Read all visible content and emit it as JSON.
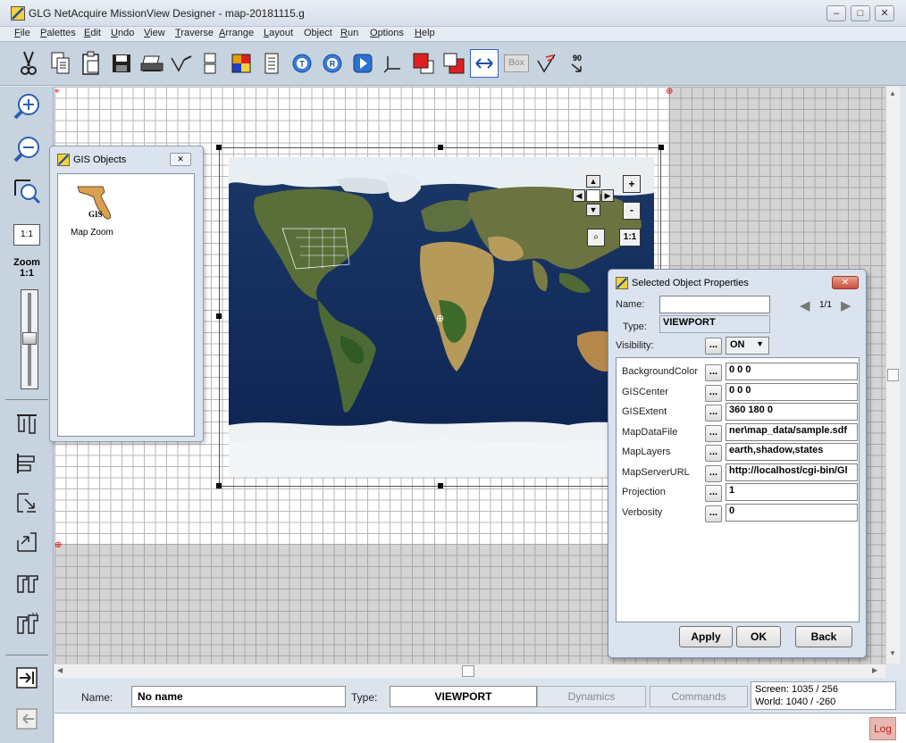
{
  "window": {
    "title": "GLG NetAcquire MissionView Designer - map-20181115.g",
    "controls": {
      "minimize": "–",
      "maximize": "□",
      "close": "✕"
    }
  },
  "menu": [
    {
      "label": "File",
      "ul": "F",
      "rest": "ile"
    },
    {
      "label": "Palettes",
      "ul": "P",
      "rest": "alettes"
    },
    {
      "label": "Edit",
      "ul": "E",
      "rest": "dit"
    },
    {
      "label": "Undo",
      "ul": "U",
      "rest": "ndo"
    },
    {
      "label": "View",
      "ul": "V",
      "rest": "iew"
    },
    {
      "label": "Traverse",
      "ul": "T",
      "rest": "raverse"
    },
    {
      "label": "Arrange",
      "ul": "A",
      "rest": "rrange"
    },
    {
      "label": "Layout",
      "ul": "L",
      "rest": "ayout"
    },
    {
      "label": "Object",
      "ul": "",
      "rest": "Object"
    },
    {
      "label": "Run",
      "ul": "R",
      "rest": "un"
    },
    {
      "label": "Options",
      "ul": "O",
      "rest": "ptions"
    },
    {
      "label": "Help",
      "ul": "H",
      "rest": "elp"
    }
  ],
  "toolbar": {
    "box_label": "Box",
    "angle_label": "90",
    "icons": [
      "cut-icon",
      "copy-icon",
      "paste-icon",
      "save-icon",
      "print-icon",
      "select-points-icon",
      "layout-icon",
      "color-palette-icon",
      "list-icon",
      "traverse-t-icon",
      "traverse-r-icon",
      "run-icon",
      "axis-icon",
      "front-icon",
      "back-icon",
      "swap-icon",
      "box-icon",
      "check-icon",
      "rotate-90-icon"
    ]
  },
  "left_toolbar": {
    "zoom_in": "zoom-in-icon",
    "zoom_out": "zoom-out-icon",
    "zoom_box": "zoom-box-icon",
    "one_to_one": "1:1",
    "zoom_label": "Zoom",
    "zoom_value": "1:1",
    "zoom_level": 0.5
  },
  "gis_palette": {
    "title": "GIS Objects",
    "item_badge": "GIS",
    "item_label": "Map Zoom"
  },
  "map_controls": {
    "plus": "+",
    "minus": "-",
    "one_to_one": "1:1"
  },
  "properties": {
    "title": "Selected Object Properties",
    "name_label": "Name:",
    "name_value": "",
    "page": "1/1",
    "type_label": "Type:",
    "type_value": "VIEWPORT",
    "visibility_label": "Visibility:",
    "visibility_value": "ON",
    "dots": "...",
    "rows": [
      {
        "label": "BackgroundColor",
        "value": "0 0 0"
      },
      {
        "label": "GISCenter",
        "value": "0 0 0"
      },
      {
        "label": "GISExtent",
        "value": "360 180 0"
      },
      {
        "label": "MapDataFile",
        "value": "ner\\map_data/sample.sdf"
      },
      {
        "label": "MapLayers",
        "value": "earth,shadow,states"
      },
      {
        "label": "MapServerURL",
        "value": "http://localhost/cgi-bin/Gl"
      },
      {
        "label": "Projection",
        "value": "1"
      },
      {
        "label": "Verbosity",
        "value": "0"
      }
    ],
    "apply": "Apply",
    "ok": "OK",
    "back": "Back"
  },
  "status": {
    "name_label": "Name:",
    "name_value": "No name",
    "type_label": "Type:",
    "type_value": "VIEWPORT",
    "dynamics": "Dynamics",
    "commands": "Commands",
    "screen": "Screen:  1035 / 256",
    "world": "World:  1040 / -260",
    "log": "Log"
  }
}
